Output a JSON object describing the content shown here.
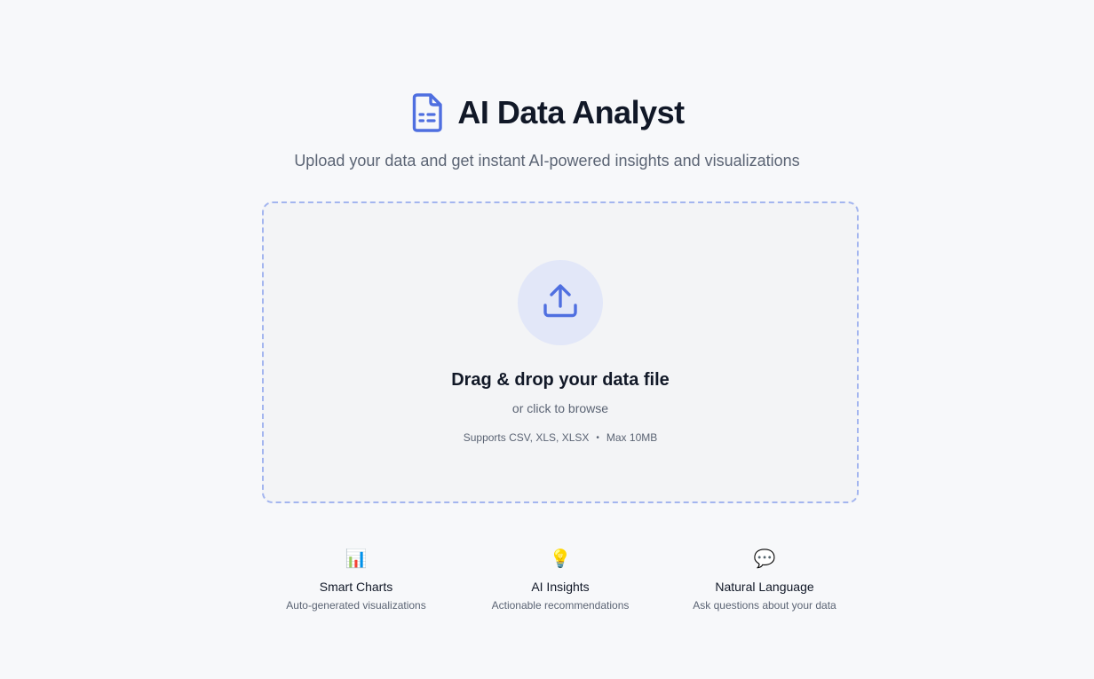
{
  "header": {
    "title": "AI Data Analyst",
    "subtitle": "Upload your data and get instant AI-powered insights and visualizations",
    "logo_icon": "spreadsheet-file-icon"
  },
  "dropzone": {
    "title": "Drag & drop your data file",
    "subtitle": "or click to browse",
    "formats": "Supports CSV, XLS, XLSX",
    "separator": "•",
    "max_size": "Max 10MB",
    "icon": "upload-icon"
  },
  "features": [
    {
      "icon": "bar-chart-icon",
      "emoji": "📊",
      "title": "Smart Charts",
      "description": "Auto-generated visualizations"
    },
    {
      "icon": "lightbulb-icon",
      "emoji": "💡",
      "title": "AI Insights",
      "description": "Actionable recommendations"
    },
    {
      "icon": "speech-bubble-icon",
      "emoji": "💬",
      "title": "Natural Language",
      "description": "Ask questions about your data"
    }
  ],
  "colors": {
    "accent": "#4f6fe0",
    "background": "#f7f8fa",
    "dropzone_border": "#a3b5ef",
    "upload_circle": "#e2e7f8"
  }
}
